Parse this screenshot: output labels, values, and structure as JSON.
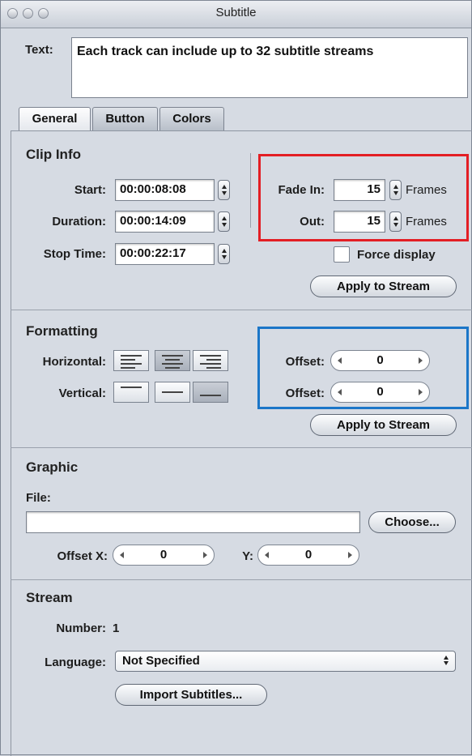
{
  "window": {
    "title": "Subtitle"
  },
  "text": {
    "label": "Text:",
    "value": "Each track can include up to 32 subtitle streams"
  },
  "tabs": [
    {
      "label": "General"
    },
    {
      "label": "Button"
    },
    {
      "label": "Colors"
    }
  ],
  "clip_info": {
    "title": "Clip Info",
    "start_label": "Start:",
    "start_value": "00:00:08:08",
    "duration_label": "Duration:",
    "duration_value": "00:00:14:09",
    "stop_label": "Stop Time:",
    "stop_value": "00:00:22:17",
    "fade_in_label": "Fade In:",
    "fade_in_value": "15",
    "fade_in_unit": "Frames",
    "out_label": "Out:",
    "out_value": "15",
    "out_unit": "Frames",
    "force_display_label": "Force display",
    "apply_label": "Apply to Stream"
  },
  "formatting": {
    "title": "Formatting",
    "horizontal_label": "Horizontal:",
    "vertical_label": "Vertical:",
    "offset1_label": "Offset:",
    "offset1_value": "0",
    "offset2_label": "Offset:",
    "offset2_value": "0",
    "apply_label": "Apply to Stream"
  },
  "graphic": {
    "title": "Graphic",
    "file_label": "File:",
    "file_value": "",
    "choose_label": "Choose...",
    "offset_x_label": "Offset X:",
    "offset_x_value": "0",
    "y_label": "Y:",
    "y_value": "0"
  },
  "stream": {
    "title": "Stream",
    "number_label": "Number:",
    "number_value": "1",
    "language_label": "Language:",
    "language_value": "Not Specified",
    "import_label": "Import Subtitles..."
  },
  "colors": {
    "highlight_red": "#e31e24",
    "highlight_blue": "#1b76c8"
  }
}
